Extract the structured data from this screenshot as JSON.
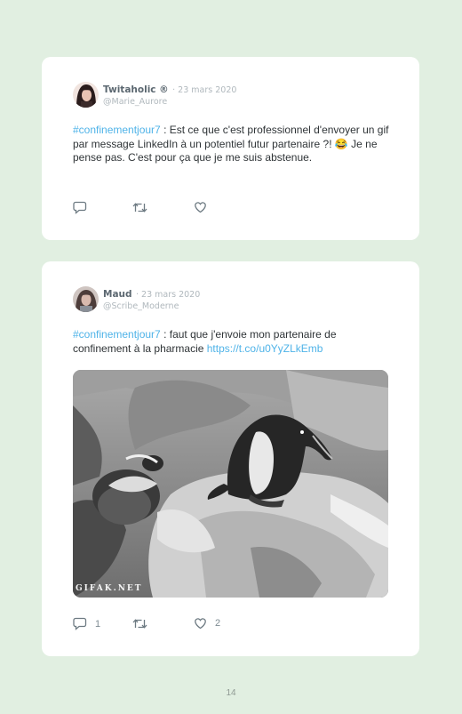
{
  "posts": [
    {
      "author": "Twitaholic ®",
      "date": "· 23 mars 2020",
      "handle": "@Marie_Aurore",
      "hashtag": "#confinementjour7",
      "text": " : Est ce que c'est professionnel d'envoyer un gif par message LinkedIn à un potentiel futur partenaire ?! 😂 Je ne pense pas. C'est pour ça que je me suis abstenue.",
      "icons": [
        "reply-icon",
        "retweet-icon",
        "heart-icon"
      ],
      "avatar_color": "#3b2a2a"
    },
    {
      "author": "Maud",
      "date": "· 23 mars 2020",
      "handle": "@Scribe_Moderne",
      "hashtag": "#confinementjour7",
      "text": " : faut que j'envoie mon partenaire de confinement à la pharmacie ",
      "link": "https://t.co/u0YyZLkEmb",
      "media_watermark": "GIFAK.NET",
      "reply_count": "1",
      "like_count": "2",
      "icons": [
        "reply-icon",
        "retweet-icon",
        "heart-icon"
      ],
      "avatar_color": "#6b5a56"
    }
  ],
  "page_number": "14",
  "colors": {
    "background": "#e1efe1",
    "card": "#ffffff",
    "accent_link": "#4fb3e8",
    "muted_text": "#b0b8bd"
  }
}
